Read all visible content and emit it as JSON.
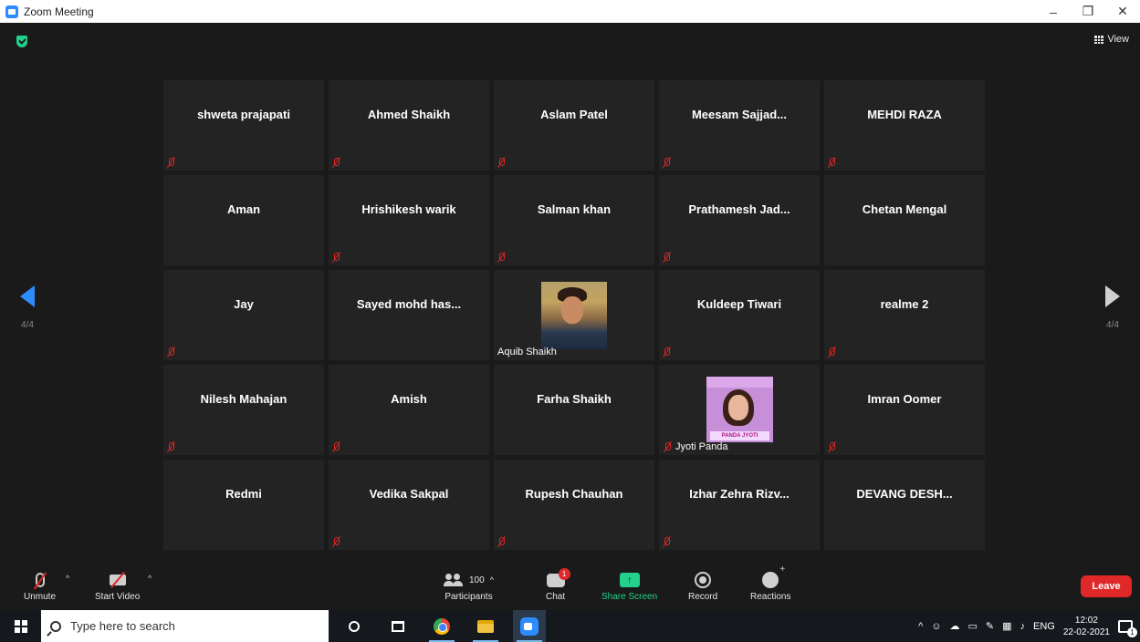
{
  "window": {
    "title": "Zoom Meeting",
    "minimize": "–",
    "restore": "❐",
    "close": "✕"
  },
  "header": {
    "view_label": "View"
  },
  "pager": {
    "left": "4/4",
    "right": "4/4"
  },
  "participants": [
    {
      "name": "shweta prajapati",
      "muted": true
    },
    {
      "name": "Ahmed Shaikh",
      "muted": true
    },
    {
      "name": "Aslam Patel",
      "muted": true
    },
    {
      "name": "Meesam  Sajjad...",
      "muted": true
    },
    {
      "name": "MEHDI RAZA",
      "muted": true
    },
    {
      "name": "Aman",
      "muted": false
    },
    {
      "name": "Hrishikesh warik",
      "muted": true
    },
    {
      "name": "Salman khan",
      "muted": true
    },
    {
      "name": "Prathamesh  Jad...",
      "muted": true
    },
    {
      "name": "Chetan Mengal",
      "muted": false
    },
    {
      "name": "Jay",
      "muted": true
    },
    {
      "name": "Sayed mohd has...",
      "muted": false
    },
    {
      "name": "Aquib Shaikh",
      "muted": false,
      "video": true
    },
    {
      "name": "Kuldeep Tiwari",
      "muted": true
    },
    {
      "name": "realme 2",
      "muted": true
    },
    {
      "name": "Nilesh Mahajan",
      "muted": true
    },
    {
      "name": "Amish",
      "muted": true
    },
    {
      "name": "Farha Shaikh",
      "muted": false
    },
    {
      "name": "Jyoti Panda",
      "muted": true,
      "video": true,
      "photo_text": "PANDA JYOTI"
    },
    {
      "name": "Imran Oomer",
      "muted": true
    },
    {
      "name": "Redmi",
      "muted": false
    },
    {
      "name": "Vedika Sakpal",
      "muted": true
    },
    {
      "name": "Rupesh Chauhan",
      "muted": true
    },
    {
      "name": "Izhar Zehra Rizv...",
      "muted": true
    },
    {
      "name": "DEVANG  DESH...",
      "muted": false
    }
  ],
  "toolbar": {
    "unmute": "Unmute",
    "start_video": "Start Video",
    "participants": "Participants",
    "participants_count": "100",
    "chat": "Chat",
    "chat_badge": "1",
    "share_screen": "Share Screen",
    "record": "Record",
    "reactions": "Reactions",
    "leave": "Leave"
  },
  "taskbar": {
    "search_placeholder": "Type here to search",
    "language": "ENG",
    "time": "12:02",
    "date": "22-02-2021",
    "notification_count": "1"
  },
  "colors": {
    "accent": "#2d8cff",
    "muted_red": "#e02828",
    "share_green": "#23d18b",
    "leave_red": "#e02828"
  }
}
